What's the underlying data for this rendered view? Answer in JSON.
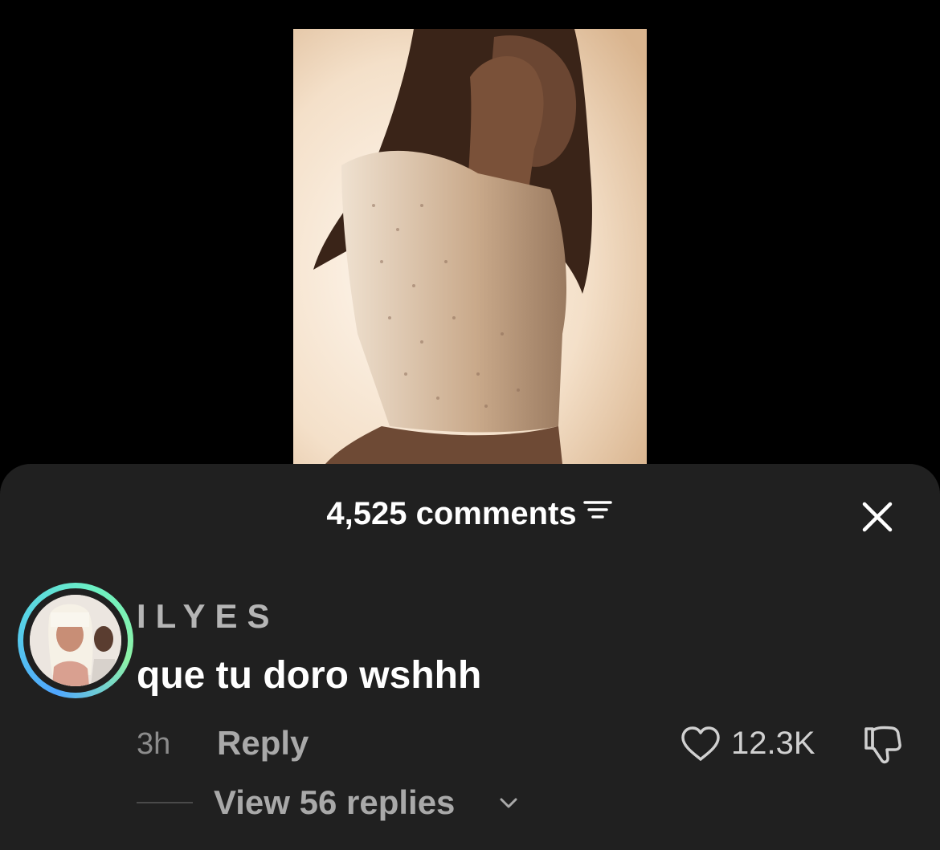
{
  "comments_sheet": {
    "count_label": "4,525 comments",
    "filter_icon": "sort-filter-icon",
    "close_icon": "close-icon"
  },
  "comment": {
    "username": "ILYES",
    "text": "que tu doro wshhh",
    "time": "3h",
    "reply_label": "Reply",
    "like_count": "12.3K",
    "like_icon": "heart-outline-icon",
    "dislike_icon": "thumbs-down-icon",
    "view_replies_label": "View 56 replies",
    "avatar_ring_colors": [
      "#4fa6ff",
      "#6cf0c2"
    ]
  },
  "colors": {
    "sheet_background": "#202020",
    "page_background": "#000000"
  }
}
